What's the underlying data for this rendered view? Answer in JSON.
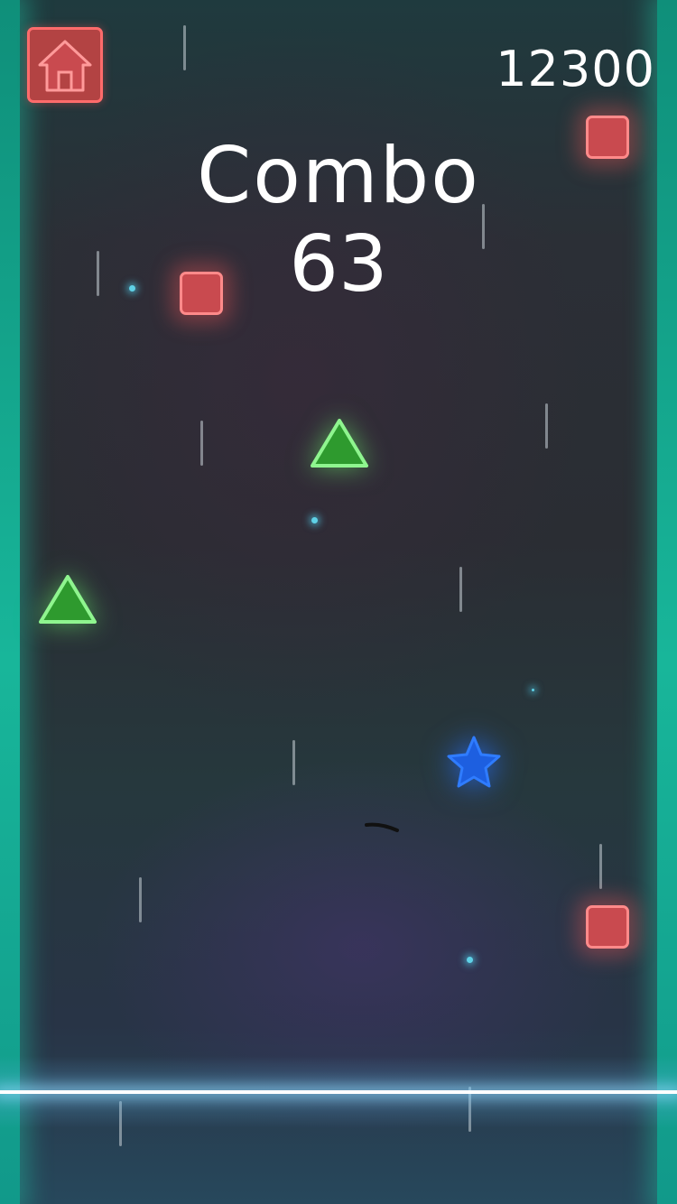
{
  "hud": {
    "home_icon": "house-icon",
    "score": "12300",
    "combo_label": "Combo",
    "combo_count": "63"
  },
  "colors": {
    "square_fill": "#c94a4f",
    "square_outline": "#ff8a8a",
    "triangle_fill": "#2e9a2e",
    "triangle_outline": "#8ff58f",
    "star_fill": "#1d5fe0",
    "side_bars": "#18b69a",
    "hit_line": "#ffffff"
  },
  "game_objects": {
    "shapes": [
      "square",
      "square",
      "triangle",
      "triangle",
      "star",
      "square"
    ]
  }
}
